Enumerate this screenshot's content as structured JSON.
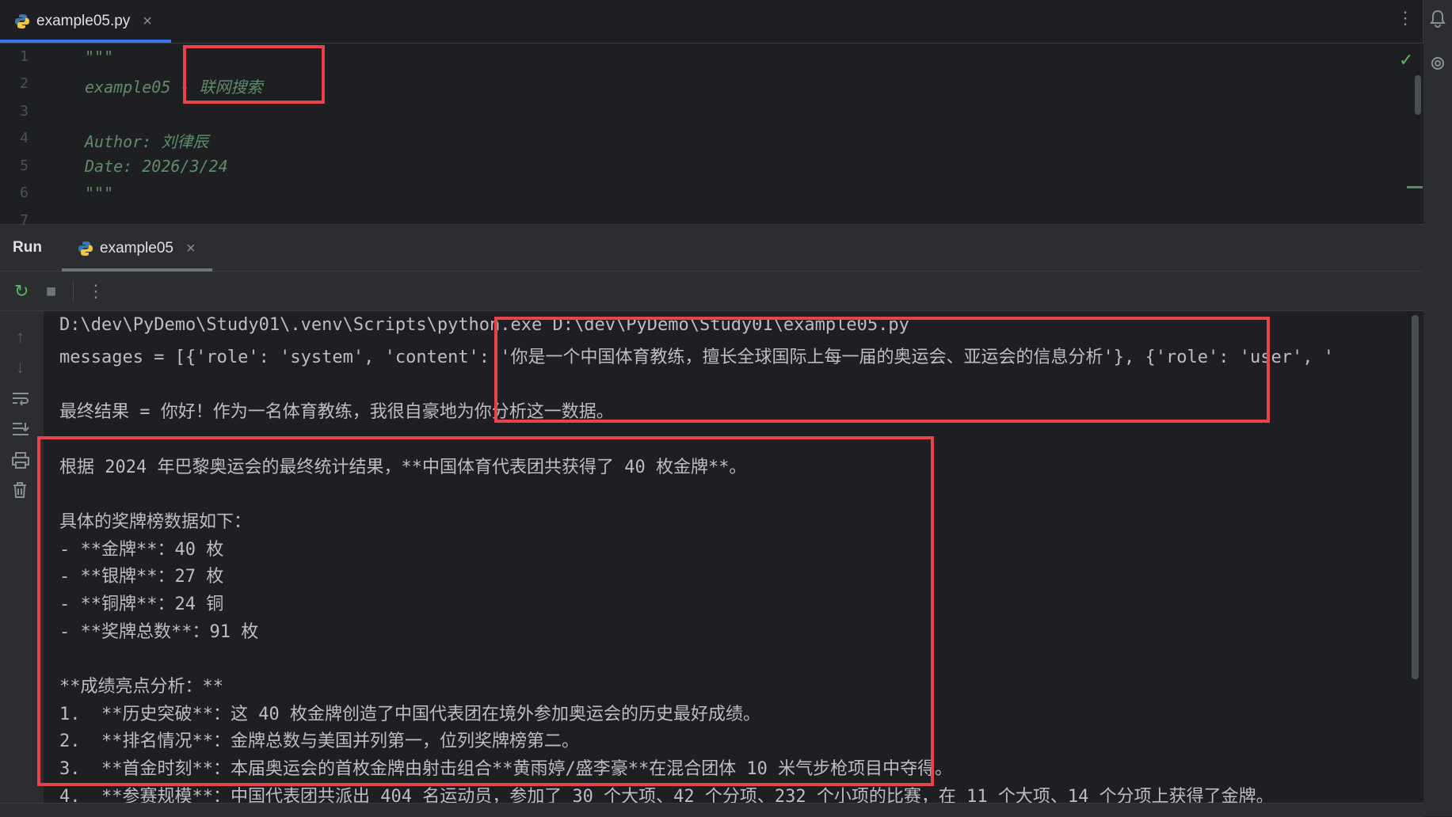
{
  "editor_tab": {
    "label": "example05.py",
    "close": "×"
  },
  "editor": {
    "line_numbers": [
      "1",
      "2",
      "3",
      "4",
      "5",
      "6",
      "7"
    ],
    "lines": [
      "\"\"\"",
      "example05 - 联网搜索",
      "",
      "Author: 刘律辰",
      "Date: 2026/3/24",
      "\"\"\"",
      ""
    ]
  },
  "run_panel": {
    "title": "Run",
    "tab_label": "example05",
    "tab_close": "×"
  },
  "console": {
    "lines": [
      "D:\\dev\\PyDemo\\Study01\\.venv\\Scripts\\python.exe D:\\dev\\PyDemo\\Study01\\example05.py",
      "messages = [{'role': 'system', 'content': '你是一个中国体育教练，擅长全球国际上每一届的奥运会、亚运会的信息分析'}, {'role': 'user', '",
      "",
      "最终结果 = 你好！作为一名体育教练，我很自豪地为你分析这一数据。",
      "",
      "根据 2024 年巴黎奥运会的最终统计结果，**中国体育代表团共获得了 40 枚金牌**。",
      "",
      "具体的奖牌榜数据如下：",
      "- **金牌**：40 枚",
      "- **银牌**：27 枚",
      "- **铜牌**：24 铜",
      "- **奖牌总数**：91 枚",
      "",
      "**成绩亮点分析：**",
      "1.  **历史突破**：这 40 枚金牌创造了中国代表团在境外参加奥运会的历史最好成绩。",
      "2.  **排名情况**：金牌总数与美国并列第一，位列奖牌榜第二。",
      "3.  **首金时刻**：本届奥运会的首枚金牌由射击组合**黄雨婷/盛李豪**在混合团体 10 米气步枪项目中夺得。",
      "4.  **参赛规模**：中国代表团共派出 404 名运动员，参加了 30 个大项、42 个分项、232 个小项的比赛，在 11 个大项、14 个分项上获得了金牌。"
    ]
  },
  "icons": {
    "python": "python-icon",
    "more": "⋮",
    "check": "✓",
    "rerun": "↻",
    "stop": "■",
    "up": "↑",
    "down": "↓",
    "wrap": "wrap-icon",
    "scroll_end": "scroll-end-icon",
    "print": "print-icon",
    "trash": "trash-icon"
  },
  "colors": {
    "accent": "#3574f0",
    "annotation_red": "#e8434a",
    "comment_green": "#5f8c6a"
  }
}
